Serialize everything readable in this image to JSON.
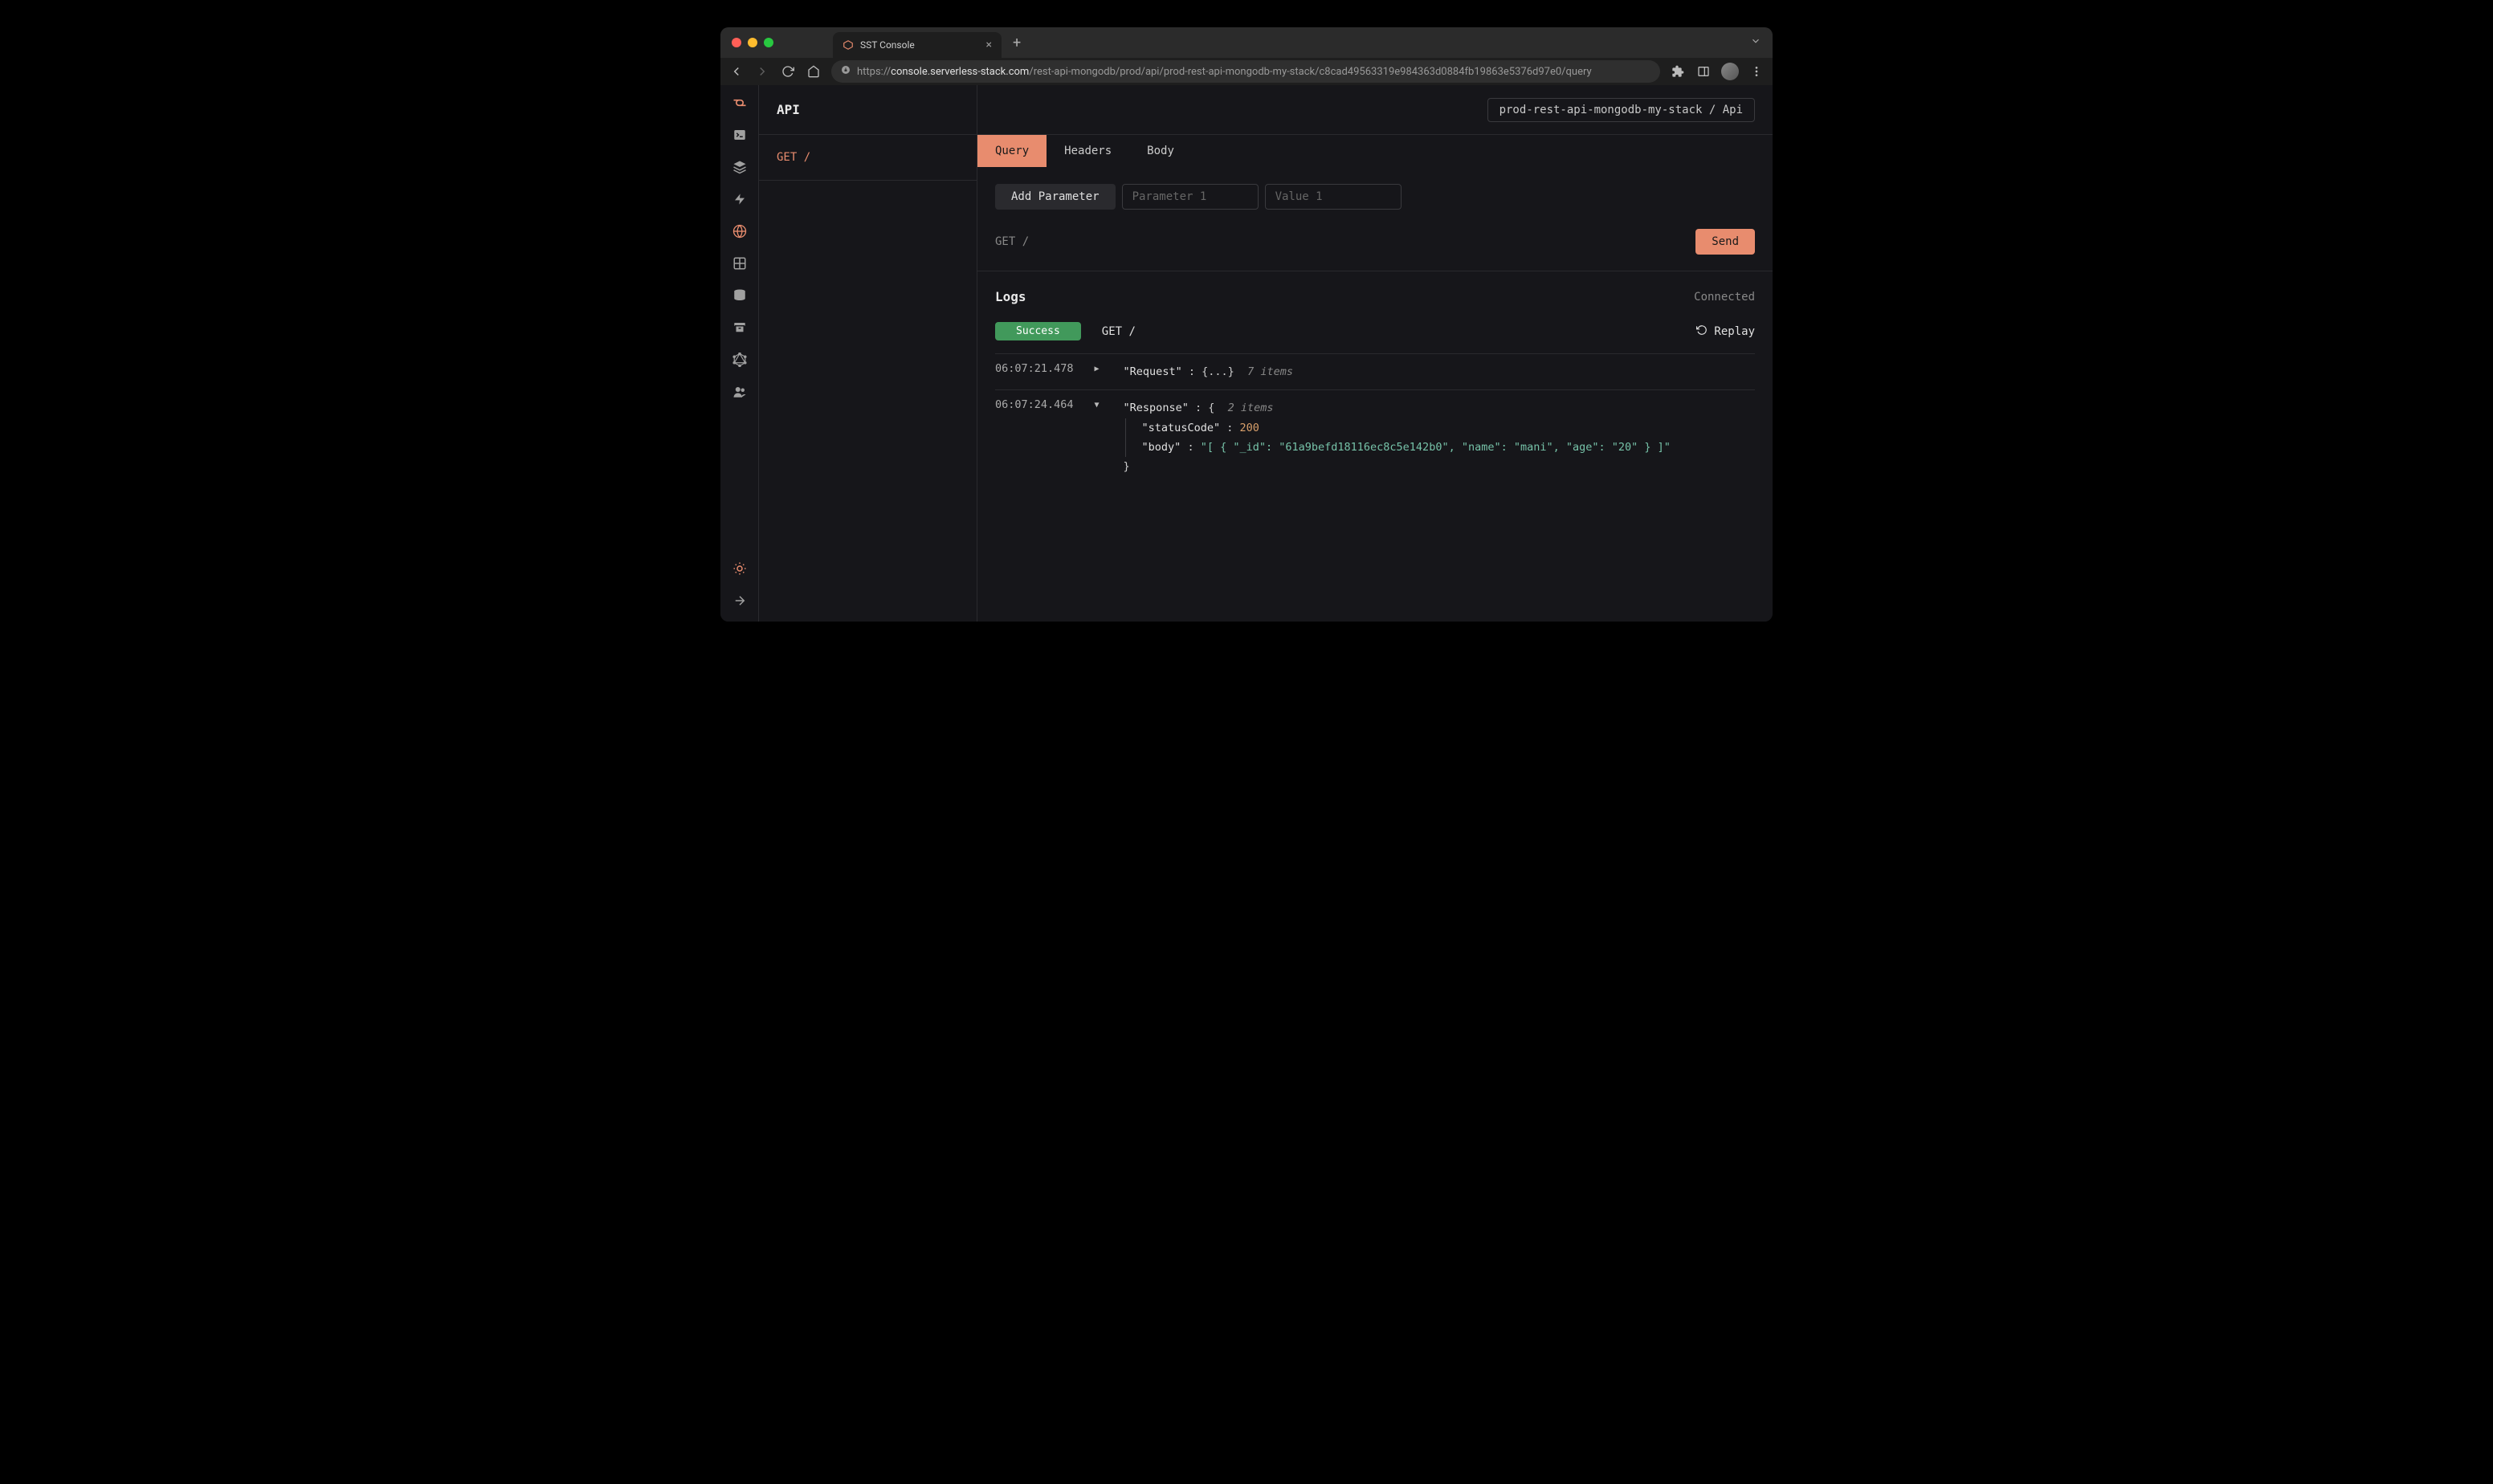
{
  "browser": {
    "tab_title": "SST Console",
    "url_protocol": "https://",
    "url_host": "console.serverless-stack.com",
    "url_path": "/rest-api-mongodb/prod/api/prod-rest-api-mongodb-my-stack/c8cad49563319e984363d0884fb19863e5376d97e0/query"
  },
  "header": {
    "title": "API",
    "breadcrumb": "prod-rest-api-mongodb-my-stack / Api"
  },
  "routes": [
    {
      "label": "GET /"
    }
  ],
  "tabs": {
    "query": "Query",
    "headers": "Headers",
    "body": "Body"
  },
  "params": {
    "add_button": "Add Parameter",
    "key_placeholder": "Parameter 1",
    "value_placeholder": "Value 1"
  },
  "request": {
    "label": "GET /",
    "send": "Send"
  },
  "logs": {
    "title": "Logs",
    "status": "Connected",
    "badge": "Success",
    "route": "GET /",
    "replay": "Replay",
    "entries": [
      {
        "time": "06:07:21.478",
        "expanded": false,
        "key": "\"Request\"",
        "brace_open": "{",
        "ellipsis": "...",
        "brace_close": "}",
        "items": "7 items"
      },
      {
        "time": "06:07:24.464",
        "expanded": true,
        "key": "\"Response\"",
        "brace_open": "{",
        "items": "2 items",
        "fields": {
          "statusCode_key": "\"statusCode\"",
          "statusCode_val": "200",
          "body_key": "\"body\"",
          "body_val": "\"[ { \"_id\": \"61a9befd18116ec8c5e142b0\", \"name\": \"mani\", \"age\": \"20\" } ]\""
        },
        "brace_close": "}"
      }
    ]
  }
}
